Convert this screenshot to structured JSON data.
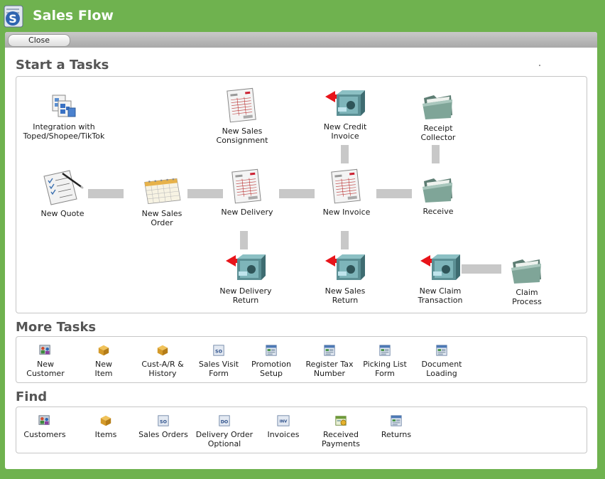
{
  "window": {
    "title": "Sales Flow"
  },
  "toolbar": {
    "close_label": "Close"
  },
  "sections": {
    "start": "Start a Tasks",
    "more": "More Tasks",
    "find": "Find"
  },
  "flow": {
    "integration": "Integration with\nToped/Shopee/TikTok",
    "consignment": "New Sales\nConsignment",
    "credit_invoice": "New Credit\nInvoice",
    "receipt_collector": "Receipt\nCollector",
    "quote": "New Quote",
    "sales_order": "New Sales\nOrder",
    "delivery": "New Delivery",
    "invoice": "New Invoice",
    "receive": "Receive",
    "delivery_return": "New Delivery\nReturn",
    "sales_return": "New Sales\nReturn",
    "claim_transaction": "New Claim\nTransaction",
    "claim_process": "Claim\nProcess"
  },
  "more_tasks": [
    {
      "label": "New\nCustomer",
      "icon": "customer-icon"
    },
    {
      "label": "New\nItem",
      "icon": "item-box-icon"
    },
    {
      "label": "Cust-A/R &\nHistory",
      "icon": "item-box-icon"
    },
    {
      "label": "Sales Visit\nForm",
      "icon": "so-form-icon",
      "tag": "SO"
    },
    {
      "label": "Promotion\nSetup",
      "icon": "form-icon"
    },
    {
      "label": "Register Tax\nNumber",
      "icon": "form-icon"
    },
    {
      "label": "Picking List\nForm",
      "icon": "form-icon"
    },
    {
      "label": "Document\nLoading",
      "icon": "form-icon"
    }
  ],
  "find": [
    {
      "label": "Customers",
      "icon": "customer-icon"
    },
    {
      "label": "Items",
      "icon": "item-box-icon"
    },
    {
      "label": "Sales Orders",
      "icon": "so-form-icon",
      "tag": "SO"
    },
    {
      "label": "Delivery Order\nOptional",
      "icon": "do-form-icon",
      "tag": "DO"
    },
    {
      "label": "Invoices",
      "icon": "inv-form-icon",
      "tag": "INV"
    },
    {
      "label": "Received\nPayments",
      "icon": "payment-icon"
    },
    {
      "label": "Returns",
      "icon": "form-icon"
    }
  ]
}
